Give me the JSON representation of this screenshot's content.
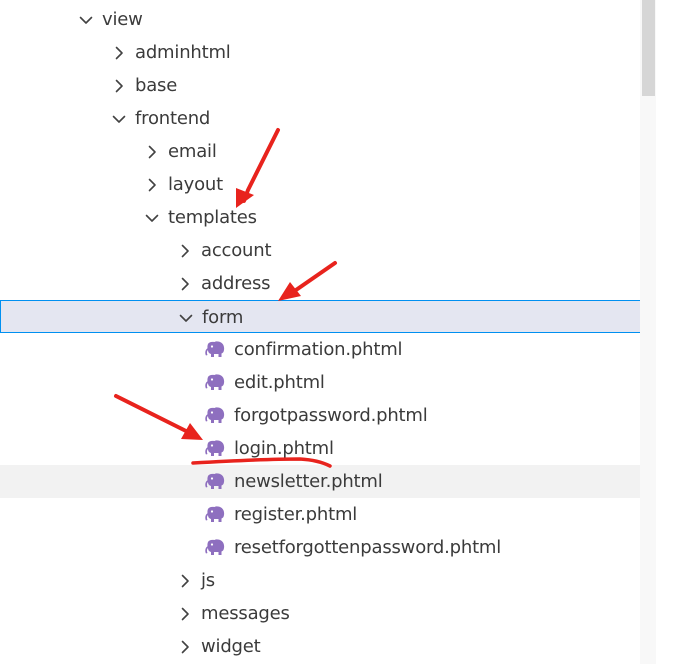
{
  "tree": [
    {
      "label": "view",
      "kind": "folder",
      "expanded": true
    },
    {
      "label": "adminhtml",
      "kind": "folder",
      "expanded": false
    },
    {
      "label": "base",
      "kind": "folder",
      "expanded": false
    },
    {
      "label": "frontend",
      "kind": "folder",
      "expanded": true
    },
    {
      "label": "email",
      "kind": "folder",
      "expanded": false
    },
    {
      "label": "layout",
      "kind": "folder",
      "expanded": false
    },
    {
      "label": "templates",
      "kind": "folder",
      "expanded": true
    },
    {
      "label": "account",
      "kind": "folder",
      "expanded": false
    },
    {
      "label": "address",
      "kind": "folder",
      "expanded": false
    },
    {
      "label": "form",
      "kind": "folder",
      "expanded": true,
      "state": "selected"
    },
    {
      "label": "confirmation.phtml",
      "kind": "file",
      "icon": "php-elephant-icon"
    },
    {
      "label": "edit.phtml",
      "kind": "file",
      "icon": "php-elephant-icon"
    },
    {
      "label": "forgotpassword.phtml",
      "kind": "file",
      "icon": "php-elephant-icon"
    },
    {
      "label": "login.phtml",
      "kind": "file",
      "icon": "php-elephant-icon"
    },
    {
      "label": "newsletter.phtml",
      "kind": "file",
      "icon": "php-elephant-icon",
      "state": "hover"
    },
    {
      "label": "register.phtml",
      "kind": "file",
      "icon": "php-elephant-icon"
    },
    {
      "label": "resetforgottenpassword.phtml",
      "kind": "file",
      "icon": "php-elephant-icon"
    },
    {
      "label": "js",
      "kind": "folder",
      "expanded": false
    },
    {
      "label": "messages",
      "kind": "folder",
      "expanded": false
    },
    {
      "label": "widget",
      "kind": "folder",
      "expanded": false
    }
  ],
  "colors": {
    "selected_background": "#e4e6f1",
    "selected_border": "#0090f1",
    "hover_background": "#f2f2f2",
    "php_icon": "#8e6fbf",
    "annotation": "#e8231d"
  }
}
